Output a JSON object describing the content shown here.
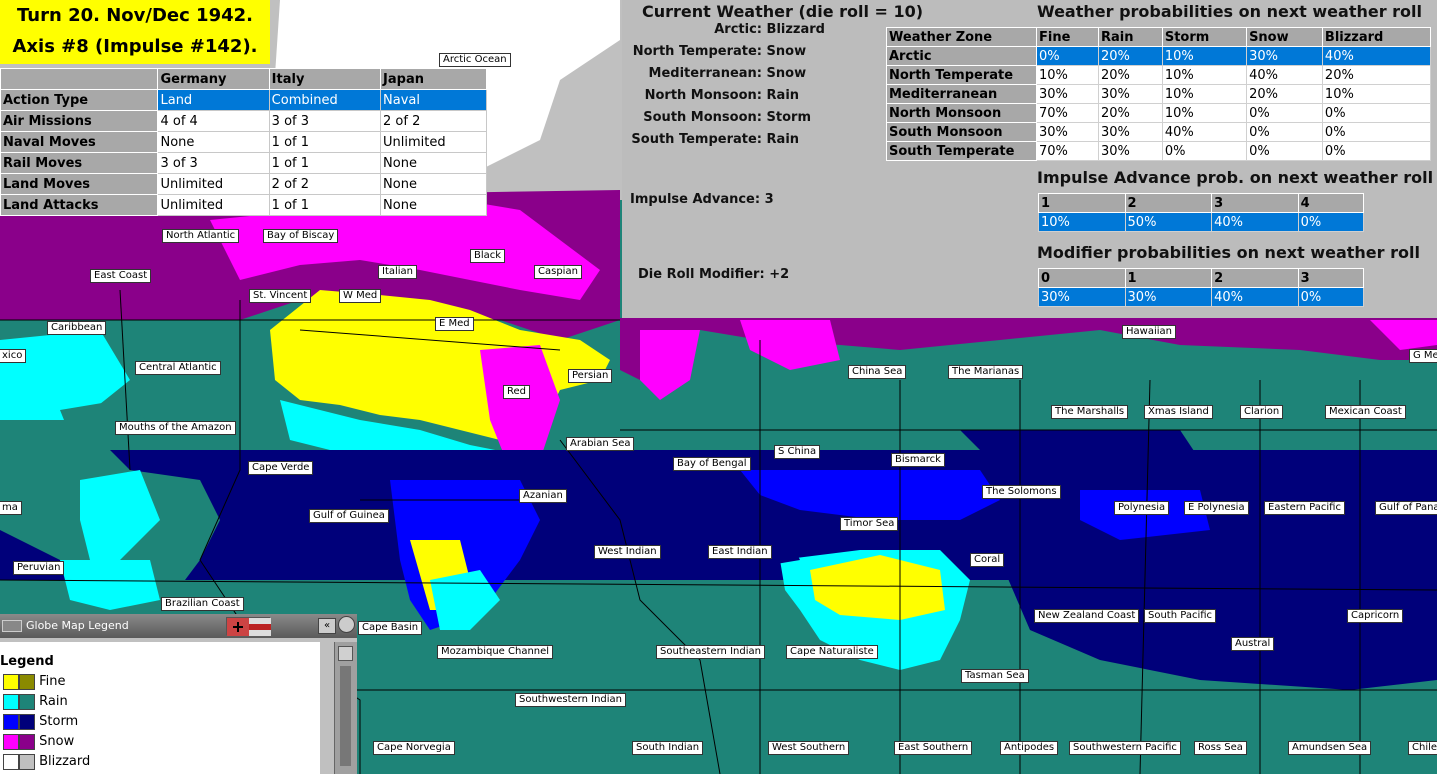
{
  "turn": {
    "line1": "Turn 20.  Nov/Dec 1942.",
    "line2": "Axis #8 (Impulse #142)."
  },
  "unit_table": {
    "headers": [
      "",
      "Germany",
      "Italy",
      "Japan"
    ],
    "rows": [
      {
        "label": "Action Type",
        "values": [
          "Land",
          "Combined",
          "Naval"
        ],
        "selected": true
      },
      {
        "label": "Air Missions",
        "values": [
          "4 of 4",
          "3 of 3",
          "2 of 2"
        ]
      },
      {
        "label": "Naval Moves",
        "values": [
          "None",
          "1 of 1",
          "Unlimited"
        ]
      },
      {
        "label": "Rail Moves",
        "values": [
          "3 of 3",
          "1 of 1",
          "None"
        ]
      },
      {
        "label": "Land Moves",
        "values": [
          "Unlimited",
          "2 of 2",
          "None"
        ]
      },
      {
        "label": "Land Attacks",
        "values": [
          "Unlimited",
          "1 of 1",
          "None"
        ]
      }
    ]
  },
  "weather": {
    "current_title": "Current Weather (die roll = 10)",
    "zones": [
      {
        "zone": "Arctic:",
        "weather": "Blizzard"
      },
      {
        "zone": "North Temperate:",
        "weather": "Snow"
      },
      {
        "zone": "Mediterranean:",
        "weather": "Snow"
      },
      {
        "zone": "North Monsoon:",
        "weather": "Rain"
      },
      {
        "zone": "South Monsoon:",
        "weather": "Storm"
      },
      {
        "zone": "South Temperate:",
        "weather": "Rain"
      }
    ],
    "impulse_advance_label": "Impulse Advance:",
    "impulse_advance_value": "3",
    "die_roll_modifier_label": "Die Roll Modifier:",
    "die_roll_modifier_value": "+2",
    "prob_title": "Weather probabilities on next weather roll",
    "prob_headers": [
      "Weather Zone",
      "Fine",
      "Rain",
      "Storm",
      "Snow",
      "Blizzard"
    ],
    "prob_rows": [
      {
        "zone": "Arctic",
        "values": [
          "0%",
          "20%",
          "10%",
          "30%",
          "40%"
        ],
        "selected": true
      },
      {
        "zone": "North Temperate",
        "values": [
          "10%",
          "20%",
          "10%",
          "40%",
          "20%"
        ]
      },
      {
        "zone": "Mediterranean",
        "values": [
          "30%",
          "30%",
          "10%",
          "20%",
          "10%"
        ]
      },
      {
        "zone": "North Monsoon",
        "values": [
          "70%",
          "20%",
          "10%",
          "0%",
          "0%"
        ]
      },
      {
        "zone": "South Monsoon",
        "values": [
          "30%",
          "30%",
          "40%",
          "0%",
          "0%"
        ]
      },
      {
        "zone": "South Temperate",
        "values": [
          "70%",
          "30%",
          "0%",
          "0%",
          "0%"
        ]
      }
    ],
    "impulse_title": "Impulse Advance prob. on next weather roll",
    "impulse_headers": [
      "1",
      "2",
      "3",
      "4"
    ],
    "impulse_values": [
      "10%",
      "50%",
      "40%",
      "0%"
    ],
    "modifier_title": "Modifier probabilities on next weather roll",
    "modifier_headers": [
      "0",
      "1",
      "2",
      "3"
    ],
    "modifier_values": [
      "30%",
      "30%",
      "40%",
      "0%"
    ]
  },
  "legend": {
    "window_title": "Globe Map Legend",
    "heading": "Legend",
    "items": [
      {
        "label": "Fine",
        "light": "#ffff00",
        "dark": "#8a8a00"
      },
      {
        "label": "Rain",
        "light": "#00ffff",
        "dark": "#1e8478"
      },
      {
        "label": "Storm",
        "light": "#0000ff",
        "dark": "#00007a"
      },
      {
        "label": "Snow",
        "light": "#ff00ff",
        "dark": "#8a008a"
      },
      {
        "label": "Blizzard",
        "light": "#ffffff",
        "dark": "#c0c0c0"
      }
    ]
  },
  "colors": {
    "fine": "#ffff00",
    "rain_light": "#00ffff",
    "rain_dark": "#1e8478",
    "storm_light": "#0000ff",
    "storm_dark": "#00007a",
    "snow_light": "#ff00ff",
    "snow_dark": "#8a008a",
    "blizzard_light": "#ffffff",
    "blizzard_dark": "#c0c0c0",
    "selection": "#0078d7"
  },
  "sea_areas": [
    {
      "name": "Arctic Ocean"
    },
    {
      "name": "North Atlantic"
    },
    {
      "name": "Bay of Biscay"
    },
    {
      "name": "Black"
    },
    {
      "name": "East Coast"
    },
    {
      "name": "Italian"
    },
    {
      "name": "Caspian"
    },
    {
      "name": "St. Vincent"
    },
    {
      "name": "W Med"
    },
    {
      "name": "E Med"
    },
    {
      "name": "Caribbean"
    },
    {
      "name": "Hawaiian"
    },
    {
      "name": "xico"
    },
    {
      "name": "G Me"
    },
    {
      "name": "Central Atlantic"
    },
    {
      "name": "Persian"
    },
    {
      "name": "China Sea"
    },
    {
      "name": "The Marianas"
    },
    {
      "name": "Red"
    },
    {
      "name": "The Marshalls"
    },
    {
      "name": "Xmas Island"
    },
    {
      "name": "Clarion"
    },
    {
      "name": "Mexican Coast"
    },
    {
      "name": "Mouths of the Amazon"
    },
    {
      "name": "Arabian Sea"
    },
    {
      "name": "S China"
    },
    {
      "name": "Bay of Bengal"
    },
    {
      "name": "Bismarck"
    },
    {
      "name": "Cape Verde"
    },
    {
      "name": "Azanian"
    },
    {
      "name": "The Solomons"
    },
    {
      "name": "Polynesia"
    },
    {
      "name": "E Polynesia"
    },
    {
      "name": "Eastern Pacific"
    },
    {
      "name": "Gulf of Pana"
    },
    {
      "name": "ma"
    },
    {
      "name": "Gulf of Guinea"
    },
    {
      "name": "Timor Sea"
    },
    {
      "name": "West Indian"
    },
    {
      "name": "East Indian"
    },
    {
      "name": "Coral"
    },
    {
      "name": "Peruvian"
    },
    {
      "name": "Brazilian Coast"
    },
    {
      "name": "New Zealand Coast"
    },
    {
      "name": "South Pacific"
    },
    {
      "name": "Capricorn"
    },
    {
      "name": "Cape Basin"
    },
    {
      "name": "Austral"
    },
    {
      "name": "Mozambique Channel"
    },
    {
      "name": "Southeastern Indian"
    },
    {
      "name": "Cape Naturaliste"
    },
    {
      "name": "Tasman Sea"
    },
    {
      "name": "Southwestern Indian"
    },
    {
      "name": "Cape Norvegia"
    },
    {
      "name": "South Indian"
    },
    {
      "name": "West Southern"
    },
    {
      "name": "East Southern"
    },
    {
      "name": "Antipodes"
    },
    {
      "name": "Southwestern Pacific"
    },
    {
      "name": "Ross Sea"
    },
    {
      "name": "Amundsen Sea"
    },
    {
      "name": "Chile"
    }
  ]
}
